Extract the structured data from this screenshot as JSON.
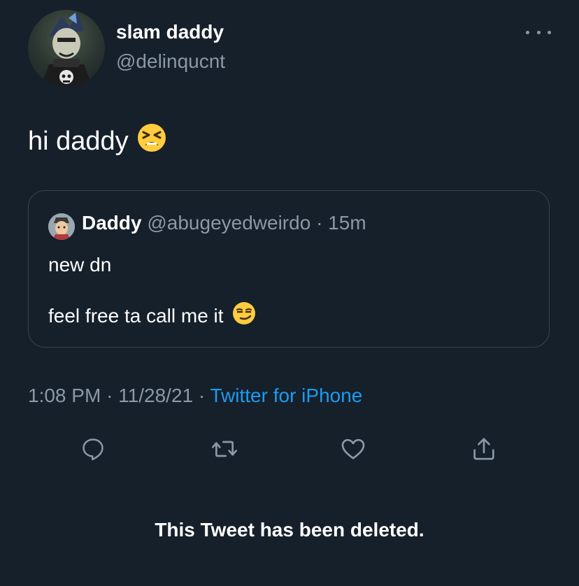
{
  "author": {
    "name": "slam daddy",
    "handle": "@delinqucnt"
  },
  "tweet": {
    "text": "hi daddy",
    "emoji": "tired-face-emoji"
  },
  "quote": {
    "name": "Daddy",
    "handle": "@abugeyedweirdo",
    "separator": "·",
    "time": "15m",
    "line1": "new dn",
    "line2": "feel free ta call me it",
    "emoji": "smirking-face-emoji"
  },
  "meta": {
    "time": "1:08 PM",
    "sep1": "·",
    "date": "11/28/21",
    "sep2": "·",
    "source": "Twitter for iPhone"
  },
  "actions": {
    "reply": "reply-icon",
    "retweet": "retweet-icon",
    "like": "heart-icon",
    "share": "share-icon"
  },
  "deleted_notice": "This Tweet has been deleted.",
  "colors": {
    "background": "#15202b",
    "text": "#ffffff",
    "muted": "#8b98a5",
    "link": "#1d9bf0",
    "border": "#38444d"
  }
}
